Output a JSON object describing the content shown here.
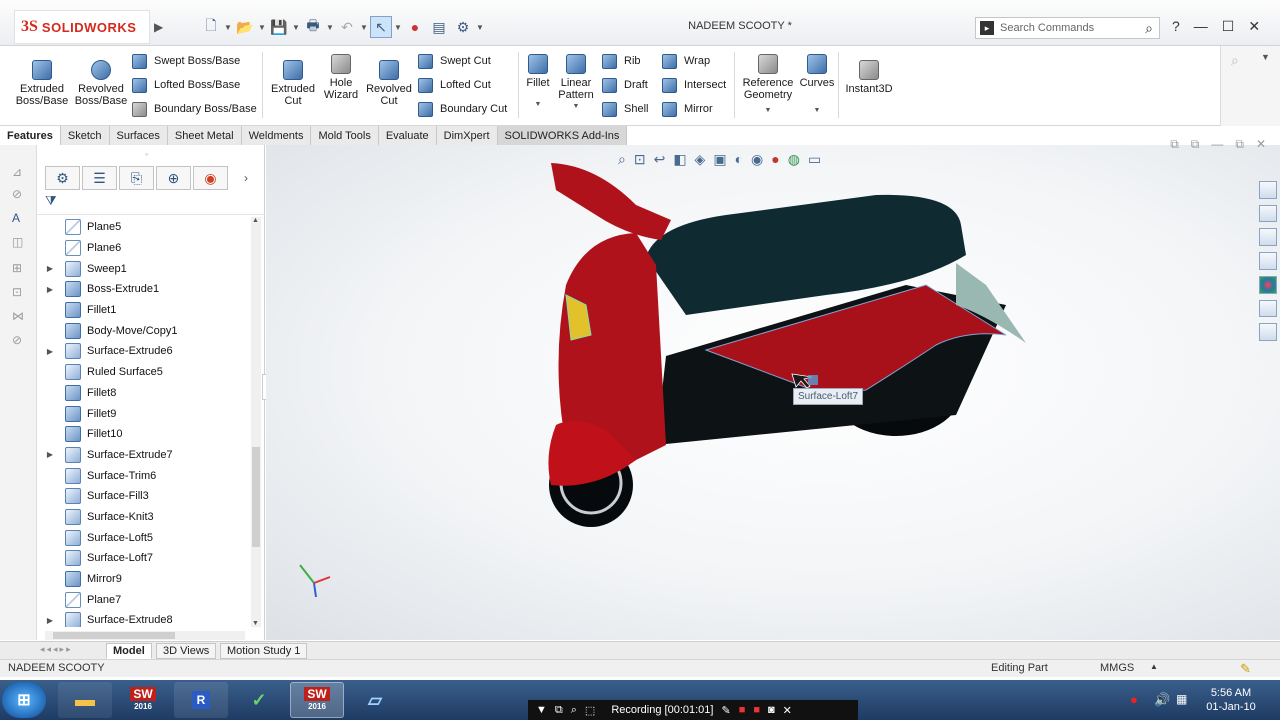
{
  "app": {
    "logo_ds": "3S",
    "logo_name": "SOLIDWORKS",
    "document_title": "NADEEM SCOOTY *"
  },
  "search": {
    "placeholder": "Search Commands"
  },
  "ribbon": {
    "extruded_boss": "Extruded Boss/Base",
    "revolved_boss": "Revolved Boss/Base",
    "swept_boss": "Swept Boss/Base",
    "lofted_boss": "Lofted Boss/Base",
    "boundary_boss": "Boundary Boss/Base",
    "extruded_cut": "Extruded Cut",
    "hole_wizard": "Hole Wizard",
    "revolved_cut": "Revolved Cut",
    "swept_cut": "Swept Cut",
    "lofted_cut": "Lofted Cut",
    "boundary_cut": "Boundary Cut",
    "fillet": "Fillet",
    "linear_pattern": "Linear Pattern",
    "rib": "Rib",
    "draft": "Draft",
    "shell": "Shell",
    "wrap": "Wrap",
    "intersect": "Intersect",
    "mirror": "Mirror",
    "reference_geometry": "Reference Geometry",
    "curves": "Curves",
    "instant3d": "Instant3D"
  },
  "tabs": [
    "Features",
    "Sketch",
    "Surfaces",
    "Sheet Metal",
    "Weldments",
    "Mold Tools",
    "Evaluate",
    "DimXpert",
    "SOLIDWORKS Add-Ins"
  ],
  "tree": [
    {
      "label": "Plane5",
      "icon": "plane",
      "expandable": false
    },
    {
      "label": "Plane6",
      "icon": "plane",
      "expandable": false
    },
    {
      "label": "Sweep1",
      "icon": "surface",
      "expandable": true
    },
    {
      "label": "Boss-Extrude1",
      "icon": "feature",
      "expandable": true
    },
    {
      "label": "Fillet1",
      "icon": "feature",
      "expandable": false
    },
    {
      "label": "Body-Move/Copy1",
      "icon": "feature",
      "expandable": false
    },
    {
      "label": "Surface-Extrude6",
      "icon": "surface",
      "expandable": true
    },
    {
      "label": "Ruled Surface5",
      "icon": "surface",
      "expandable": false
    },
    {
      "label": "Fillet8",
      "icon": "feature",
      "expandable": false
    },
    {
      "label": "Fillet9",
      "icon": "feature",
      "expandable": false
    },
    {
      "label": "Fillet10",
      "icon": "feature",
      "expandable": false
    },
    {
      "label": "Surface-Extrude7",
      "icon": "surface",
      "expandable": true
    },
    {
      "label": "Surface-Trim6",
      "icon": "surface",
      "expandable": false
    },
    {
      "label": "Surface-Fill3",
      "icon": "surface",
      "expandable": false
    },
    {
      "label": "Surface-Knit3",
      "icon": "surface",
      "expandable": false
    },
    {
      "label": "Surface-Loft5",
      "icon": "surface",
      "expandable": false
    },
    {
      "label": "Surface-Loft7",
      "icon": "surface",
      "expandable": false
    },
    {
      "label": "Mirror9",
      "icon": "feature",
      "expandable": false
    },
    {
      "label": "Plane7",
      "icon": "plane",
      "expandable": false
    },
    {
      "label": "Surface-Extrude8",
      "icon": "surface",
      "expandable": true
    }
  ],
  "viewport": {
    "tooltip": "Surface-Loft7"
  },
  "bottom_tabs": [
    "Model",
    "3D Views",
    "Motion Study 1"
  ],
  "status": {
    "left": "NADEEM SCOOTY",
    "mode": "Editing Part",
    "units": "MMGS"
  },
  "taskbar": {
    "recording": "Recording [00:01:01]",
    "time": "5:56 AM",
    "date": "01-Jan-10",
    "sw_label": "SW",
    "sw_year": "2016",
    "r_label": "R"
  }
}
